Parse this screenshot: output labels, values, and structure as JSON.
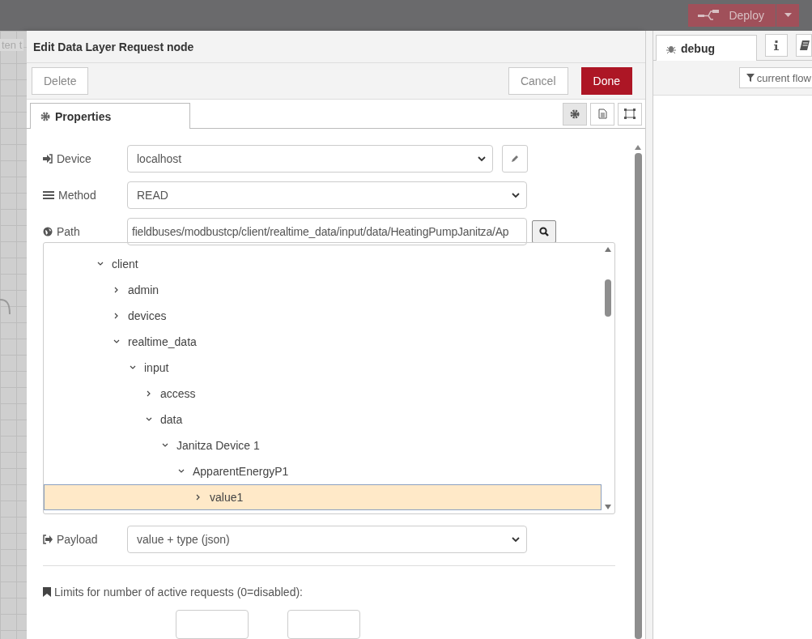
{
  "header": {
    "deploy_label": "Deploy"
  },
  "canvas": {
    "tab_label": "ten t"
  },
  "dialog": {
    "title": "Edit Data Layer Request node",
    "buttons": [
      {
        "label": "Delete",
        "kind": "plain"
      },
      {
        "label": "Cancel",
        "kind": "plain"
      },
      {
        "label": "Done",
        "kind": "primary"
      }
    ],
    "tabs": [
      {
        "label": "Properties",
        "selected": true
      }
    ],
    "fields": [
      {
        "label": "Device",
        "kind": "select",
        "value": "localhost",
        "edit_button": true
      },
      {
        "label": "Method",
        "kind": "select",
        "value": "READ",
        "edit_button": false
      },
      {
        "label": "Path",
        "kind": "input",
        "value": "fieldbuses/modbustcp/client/realtime_data/input/data/HeatingPumpJanitza/Ap"
      }
    ],
    "tree": [
      {
        "label": "client",
        "expanded": true,
        "selected": false,
        "children": [
          {
            "label": "admin",
            "expanded": false,
            "selected": false
          },
          {
            "label": "devices",
            "expanded": false,
            "selected": false
          },
          {
            "label": "realtime_data",
            "expanded": true,
            "selected": false,
            "children": [
              {
                "label": "input",
                "expanded": true,
                "selected": false,
                "children": [
                  {
                    "label": "access",
                    "expanded": false,
                    "selected": false
                  },
                  {
                    "label": "data",
                    "expanded": true,
                    "selected": false,
                    "children": [
                      {
                        "label": "Janitza Device 1",
                        "expanded": true,
                        "selected": false,
                        "children": [
                          {
                            "label": "ApparentEnergyP1",
                            "expanded": true,
                            "selected": false,
                            "children": [
                              {
                                "label": "value1",
                                "expanded": false,
                                "selected": true
                              }
                            ]
                          }
                        ]
                      }
                    ]
                  }
                ]
              }
            ]
          }
        ]
      }
    ],
    "payload": {
      "label": "Payload",
      "value": "value + type (json)"
    },
    "limits_label": "Limits for number of active requests (0=disabled):"
  },
  "sidebar": {
    "tabs": [
      {
        "label": "debug",
        "selected": true
      }
    ],
    "filter_label": "current flow"
  }
}
